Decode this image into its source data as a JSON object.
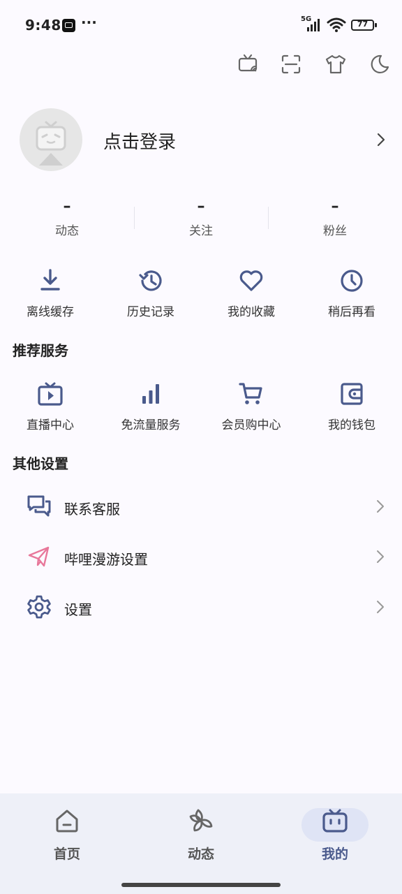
{
  "status_bar": {
    "time": "9:48",
    "dots": "···",
    "network": "5G",
    "battery": "77"
  },
  "toolbar": {
    "icons": [
      "cast-icon",
      "scan-icon",
      "theme-shirt-icon",
      "night-mode-icon"
    ]
  },
  "profile": {
    "login_text": "点击登录"
  },
  "stats": [
    {
      "value": "–",
      "label": "动态"
    },
    {
      "value": "–",
      "label": "关注"
    },
    {
      "value": "–",
      "label": "粉丝"
    }
  ],
  "quick_actions": [
    {
      "label": "离线缓存",
      "icon": "download-icon"
    },
    {
      "label": "历史记录",
      "icon": "history-icon"
    },
    {
      "label": "我的收藏",
      "icon": "heart-icon"
    },
    {
      "label": "稍后再看",
      "icon": "clock-icon"
    }
  ],
  "recommended": {
    "title": "推荐服务",
    "items": [
      {
        "label": "直播中心",
        "icon": "live-tv-icon"
      },
      {
        "label": "免流量服务",
        "icon": "signal-bars-icon"
      },
      {
        "label": "会员购中心",
        "icon": "shopping-cart-icon"
      },
      {
        "label": "我的钱包",
        "icon": "wallet-icon"
      }
    ]
  },
  "other_settings": {
    "title": "其他设置",
    "items": [
      {
        "label": "联系客服",
        "icon": "chat-icon"
      },
      {
        "label": "哔哩漫游设置",
        "icon": "paper-plane-icon"
      },
      {
        "label": "设置",
        "icon": "gear-icon"
      }
    ]
  },
  "bottom_nav": [
    {
      "label": "首页",
      "icon": "home-icon"
    },
    {
      "label": "动态",
      "icon": "pinwheel-icon"
    },
    {
      "label": "我的",
      "icon": "bilibili-tv-icon",
      "active": true
    }
  ],
  "colors": {
    "accent": "#4a5a8c",
    "pink": "#e8779a",
    "background": "#fcfaff",
    "nav_background": "#eef0f8"
  }
}
